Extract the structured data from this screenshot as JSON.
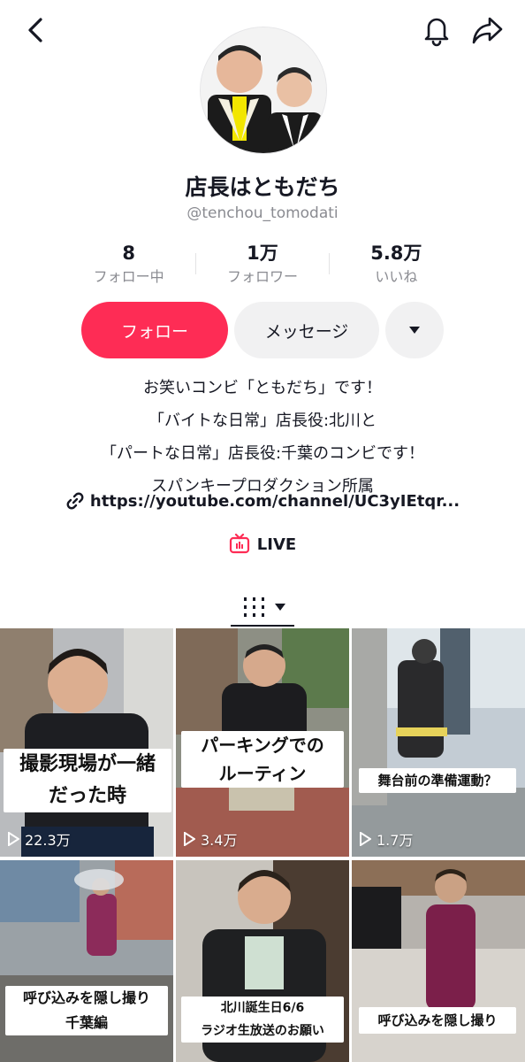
{
  "header": {
    "back_icon": "chevron-left-icon",
    "bell_icon": "bell-icon",
    "share_icon": "share-arrow-icon"
  },
  "profile": {
    "name": "店長はともだち",
    "handle": "@tenchou_tomodati"
  },
  "stats": [
    {
      "value": "8",
      "label": "フォロー中"
    },
    {
      "value": "1万",
      "label": "フォロワー"
    },
    {
      "value": "5.8万",
      "label": "いいね"
    }
  ],
  "actions": {
    "follow_label": "フォロー",
    "message_label": "メッセージ",
    "more_icon": "triangle-down-icon"
  },
  "bio": {
    "lines": [
      "お笑いコンビ「ともだち」です！",
      "「バイトな日常」店長役:北川と",
      "「パートな日常」店長役:千葉のコンビです！",
      "スパンキープロダクション所属"
    ],
    "link": "https://youtube.com/channel/UC3yIEtqr..."
  },
  "live": {
    "label": "LIVE"
  },
  "tabs": {
    "active_icon": "grid-icon"
  },
  "videos": [
    {
      "caption": "撮影現場が一緒\nだった時",
      "views": "22.3万"
    },
    {
      "caption": "パーキングでの\nルーティン",
      "views": "3.4万"
    },
    {
      "caption": "舞台前の準備運動？",
      "views": "1.7万"
    },
    {
      "caption": "呼び込みを隠し撮り\n千葉編",
      "views": ""
    },
    {
      "caption": "北川誕生日6/6\nラジオ生放送のお願い",
      "views": ""
    },
    {
      "caption": "呼び込みを隠し撮り",
      "views": ""
    }
  ],
  "colors": {
    "accent": "#fe2c55",
    "text": "#161823",
    "muted": "#8a8b91",
    "button_bg": "#f1f1f2"
  }
}
